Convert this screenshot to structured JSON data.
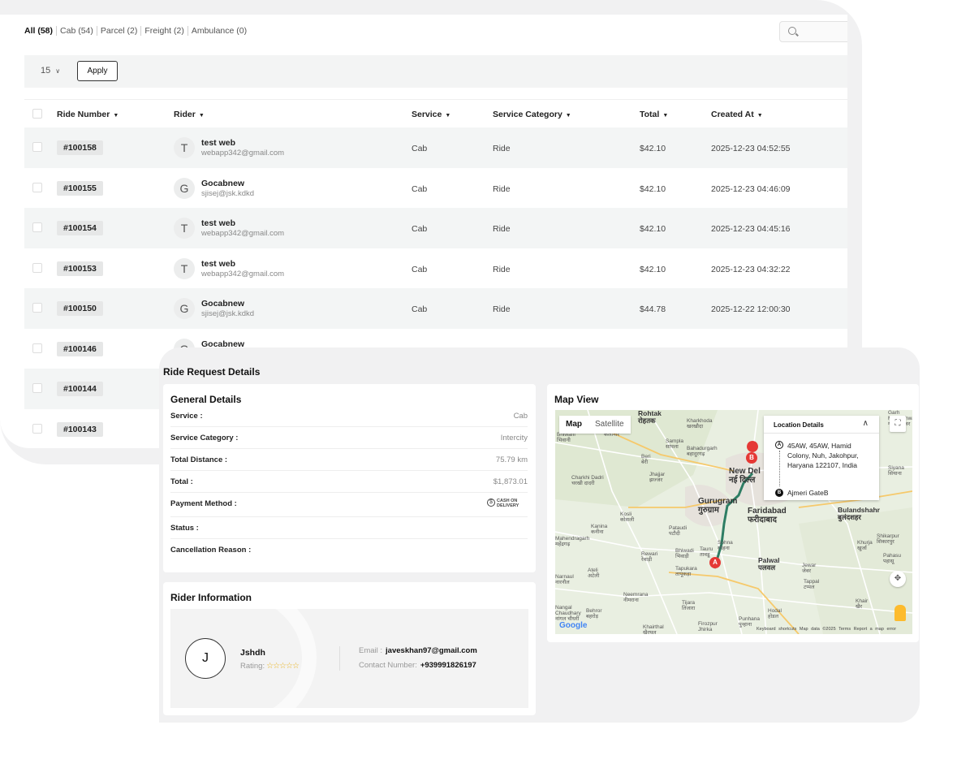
{
  "list": {
    "filters": [
      "All (58)",
      "Cab (54)",
      "Parcel (2)",
      "Freight (2)",
      "Ambulance (0)"
    ],
    "per_page": "15",
    "apply_label": "Apply",
    "columns": [
      "Ride Number",
      "Rider",
      "Service",
      "Service Category",
      "Total",
      "Created At"
    ],
    "sort_icon": "triangle-down",
    "rows": [
      {
        "ride": "#100158",
        "initial": "T",
        "name": "test web",
        "email": "webapp342@gmail.com",
        "service": "Cab",
        "category": "Ride",
        "total": "$42.10",
        "created": "2025-12-23 04:52:55"
      },
      {
        "ride": "#100155",
        "initial": "G",
        "name": "Gocabnew",
        "email": "sjisej@jsk.kdkd",
        "service": "Cab",
        "category": "Ride",
        "total": "$42.10",
        "created": "2025-12-23 04:46:09"
      },
      {
        "ride": "#100154",
        "initial": "T",
        "name": "test web",
        "email": "webapp342@gmail.com",
        "service": "Cab",
        "category": "Ride",
        "total": "$42.10",
        "created": "2025-12-23 04:45:16"
      },
      {
        "ride": "#100153",
        "initial": "T",
        "name": "test web",
        "email": "webapp342@gmail.com",
        "service": "Cab",
        "category": "Ride",
        "total": "$42.10",
        "created": "2025-12-23 04:32:22"
      },
      {
        "ride": "#100150",
        "initial": "G",
        "name": "Gocabnew",
        "email": "sjisej@jsk.kdkd",
        "service": "Cab",
        "category": "Ride",
        "total": "$44.78",
        "created": "2025-12-22 12:00:30"
      },
      {
        "ride": "#100146",
        "initial": "G",
        "name": "Gocabnew",
        "email": "",
        "service": "",
        "category": "",
        "total": "",
        "created": ""
      },
      {
        "ride": "#100144",
        "initial": "",
        "name": "",
        "email": "",
        "service": "",
        "category": "",
        "total": "",
        "created": ""
      },
      {
        "ride": "#100143",
        "initial": "",
        "name": "",
        "email": "",
        "service": "",
        "category": "",
        "total": "",
        "created": ""
      }
    ]
  },
  "details": {
    "title": "Ride Request Details",
    "general": {
      "title": "General Details",
      "rows": [
        {
          "label": "Service :",
          "value": "Cab"
        },
        {
          "label": "Service Category :",
          "value": "Intercity"
        },
        {
          "label": "Total Distance :",
          "value": "75.79 km"
        },
        {
          "label": "Total :",
          "value": "$1,873.01"
        },
        {
          "label": "Payment Method :",
          "value": ""
        },
        {
          "label": "Status :",
          "value": ""
        },
        {
          "label": "Cancellation Reason :",
          "value": ""
        }
      ],
      "payment_badge": "CASH ON DELIVERY",
      "payment_icon": "dollar-circle-icon"
    },
    "rider": {
      "title": "Rider Information",
      "initial": "J",
      "name": "Jshdh",
      "rating_label": "Rating:",
      "rating": 0,
      "rating_max": 5,
      "email_label": "Email :",
      "email": "javeskhan97@gmail.com",
      "phone_label": "Contact Number:",
      "phone": "+939991826197"
    },
    "map": {
      "title": "Map View",
      "tabs": [
        "Map",
        "Satellite"
      ],
      "location_title": "Location Details",
      "pickup": "45AW, 45AW, Hamid Colony, Nuh, Jakohpur, Haryana 122107, India",
      "drop": "Ajmeri GateB",
      "marker_a": "A",
      "marker_b": "B",
      "footer": "Keyboard shortcuts   Map data ©2025   Terms   Report a map error",
      "logo": "Google",
      "labels": {
        "rohtak": "Rohtak\nरोहतक",
        "kharkhoda": "Kharkhoda\nखरखौदा",
        "bhiwani": "Bhiwani\nभिवानी",
        "sampla": "Sampla\nसांपला",
        "bahadurgarh": "Bahadurgarh\nबहादुरगढ़",
        "beri": "Beri\nबेरी",
        "jhajjar": "Jhajjar\nझज्जर",
        "newdelhi": "New Del\nनई दिल्ल",
        "charkhi": "Charkhi Dadri\nचरखी दादरी",
        "gurugram": "Gurugram\nगुरुग्राम",
        "faridabad": "Faridabad\nफरीदाबाद",
        "kosli": "Kosli\nकोसली",
        "kanina": "Kanina\nकनीना",
        "pataudi": "Pataudi\nपटौदी",
        "sohna": "Sohna\nसोहना",
        "bulandshahr": "Bulandshahr\nबुलंदशहर",
        "mahendragarh": "Mahendragarh\nमहेंद्रगढ़",
        "rewari": "Rewari\nरेवाड़ी",
        "bhiwadi": "Bhiwadi\nभिवाड़ी",
        "tauru": "Tauru\nतावडू",
        "palwal": "Palwal\nपलवल",
        "shikarpur": "Shikarpur\nशिकारपुर",
        "khurja": "Khurja\nखुर्जा",
        "pahasu": "Pahasu\nपहासू",
        "narnaul": "Narnaul\nनारनौल",
        "ateli": "Ateli\nअटेली",
        "tapukara": "Tapukara\nतापूकड़ा",
        "jewar": "Jewar\nजेवर",
        "tappal": "Tappal\nटप्पल",
        "neemrana": "Neemrana\nनीमराना",
        "tijara": "Tijara\nतिजारा",
        "hodal": "Hodal\nहोडल",
        "khair": "Khair\nखैर",
        "nangal": "Nangal\nChaudhary\nनांगल चौधरी",
        "behror": "Behror\nबहरोड़",
        "punhana": "Punhana\nपुन्हाना",
        "khairthal": "Khairthal\nखैरथल",
        "firozpur": "Firozpur\nJhirka",
        "garh": "Garh\nMukteshwar\nगढ़मुक्तेश्वर",
        "siyana": "Siyana\nसियाना",
        "kalanaur": "कलानौर"
      },
      "route_color": "#2e7d64",
      "marker_color": "#e53935"
    }
  }
}
